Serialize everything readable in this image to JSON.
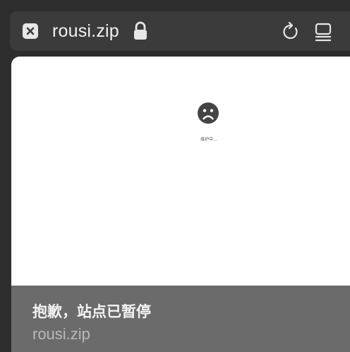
{
  "address_bar": {
    "url": "rousi.zip",
    "close_icon": "close-tab-icon",
    "lock_icon": "lock-icon",
    "reload_icon": "reload-icon",
    "tabs_icon": "tab-overview-icon"
  },
  "page": {
    "icon": "sad-face-icon",
    "status_text": "维护中..."
  },
  "info_panel": {
    "title": "抱歉，站点已暂停",
    "url": "rousi.zip"
  },
  "colors": {
    "chrome_background": "#2d2d2d",
    "address_bar": "#3b3b3b",
    "panel_background": "#6b6b6b",
    "page_background": "#ffffff"
  }
}
